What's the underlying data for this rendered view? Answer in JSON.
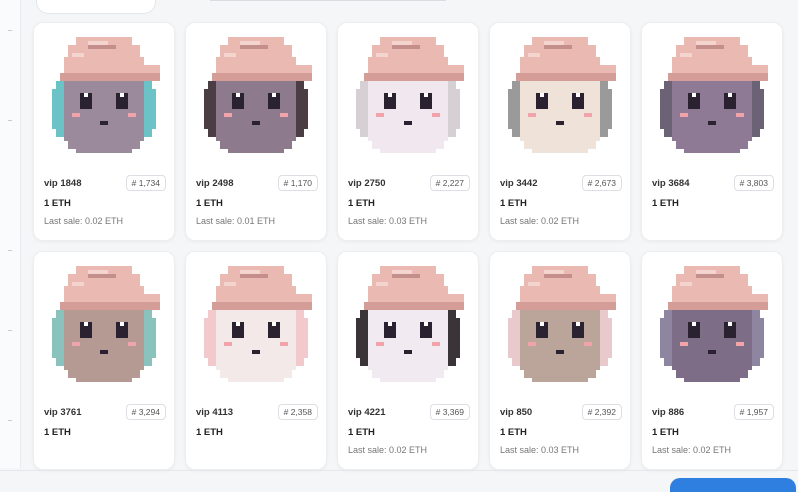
{
  "items": [
    {
      "name": "vip 1848",
      "rank": "# 1,734",
      "price": "1 ETH",
      "last_sale": "Last sale: 0.02 ETH",
      "skin": "#9b8a9b",
      "hair": "#6cc3c7",
      "bg": "#ffffff"
    },
    {
      "name": "vip 2498",
      "rank": "# 1,170",
      "price": "1 ETH",
      "last_sale": "Last sale: 0.01 ETH",
      "skin": "#8e7a8d",
      "hair": "#4b3d43",
      "bg": "#ffffff"
    },
    {
      "name": "vip 2750",
      "rank": "# 2,227",
      "price": "1 ETH",
      "last_sale": "Last sale: 0.03 ETH",
      "skin": "#f0e8ee",
      "hair": "#d6d0d4",
      "bg": "#ffffff"
    },
    {
      "name": "vip 3442",
      "rank": "# 2,673",
      "price": "1 ETH",
      "last_sale": "Last sale: 0.02 ETH",
      "skin": "#efe3d9",
      "hair": "#9a9a9a",
      "bg": "#ffffff"
    },
    {
      "name": "vip 3684",
      "rank": "# 3,803",
      "price": "1 ETH",
      "last_sale": "",
      "skin": "#8e7a95",
      "hair": "#6b6375",
      "bg": "#ffffff"
    },
    {
      "name": "vip 3761",
      "rank": "# 3,294",
      "price": "1 ETH",
      "last_sale": "",
      "skin": "#b49a92",
      "hair": "#8ac2bd",
      "bg": "#ffffff"
    },
    {
      "name": "vip 4113",
      "rank": "# 2,358",
      "price": "1 ETH",
      "last_sale": "",
      "skin": "#f3e9e8",
      "hair": "#f2c9cc",
      "bg": "#ffffff"
    },
    {
      "name": "vip 4221",
      "rank": "# 3,369",
      "price": "1 ETH",
      "last_sale": "Last sale: 0.02 ETH",
      "skin": "#f1eaf0",
      "hair": "#3a3438",
      "bg": "#ffffff"
    },
    {
      "name": "vip 850",
      "rank": "# 2,392",
      "price": "1 ETH",
      "last_sale": "Last sale: 0.03 ETH",
      "skin": "#bba59a",
      "hair": "#e8c9cc",
      "bg": "#ffffff"
    },
    {
      "name": "vip 886",
      "rank": "# 1,957",
      "price": "1 ETH",
      "last_sale": "Last sale: 0.02 ETH",
      "skin": "#7e6d86",
      "hair": "#8e86a0",
      "bg": "#ffffff"
    }
  ],
  "colors": {
    "hat": "#e9b9b2",
    "hat_shadow": "#d59d97",
    "hat_highlight": "#f4d4cf",
    "hat_stripe": "#c48f8a",
    "eye": "#2a2230",
    "blush": "#f0a3a8",
    "accent_button": "#2f7fe0"
  }
}
